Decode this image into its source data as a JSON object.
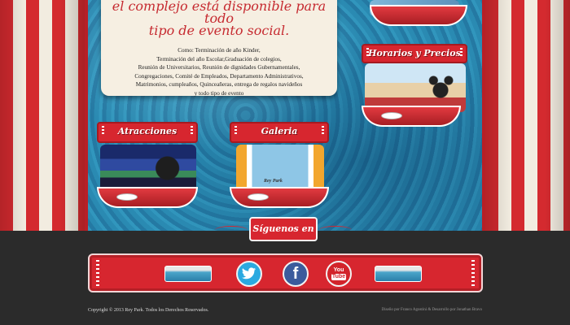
{
  "info": {
    "heading_line1": "el complejo está disponible para todo",
    "heading_line2": "tipo de evento social.",
    "body": [
      "Como: Terminación de año Kinder,",
      "Terminación del año Escolar,Graduación de colegios,",
      "Reunión de Universitarios, Reunión de dignidades Gubernamentales,",
      "Congregaciones, Comité de Empleados, Departamento Administrativos,",
      "Matrimonios, cumpleaños, Quinceañeras, entrega de regalos navideños",
      "y todo tipo de evento"
    ]
  },
  "panels": {
    "horarios": "Horarios y Precios",
    "atracciones": "Atracciones",
    "galeria": "Galeria",
    "galeria_caption": "Rey Park"
  },
  "footer": {
    "follow": "Síguenos en",
    "copyright": "Copyright © 2013 Rey Park. Todos los Derechos Reservados.",
    "credits": "Diseño por Franco Agostini  &  Desarrollo por Jonathan Bravo"
  },
  "social": [
    {
      "name": "twitter-icon",
      "glyph": "t",
      "color": "#2aa9e0"
    },
    {
      "name": "facebook-icon",
      "glyph": "f",
      "color": "#3b5b9c"
    },
    {
      "name": "youtube-icon",
      "glyph": "You Tube",
      "color": "#d2242b"
    }
  ]
}
